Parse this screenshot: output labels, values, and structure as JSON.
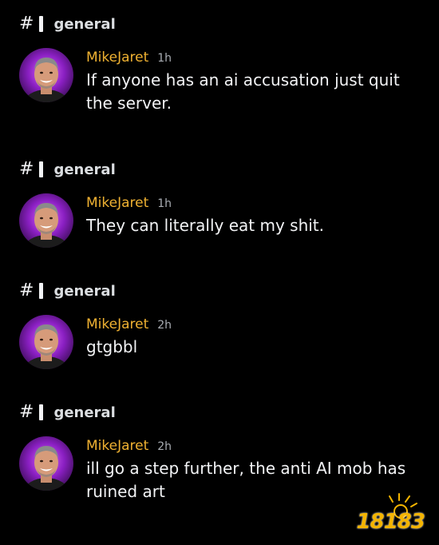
{
  "messages": [
    {
      "channel": "general",
      "username": "MikeJaret",
      "time": "1h",
      "text": "If anyone has an ai accusation just quit the server."
    },
    {
      "channel": "general",
      "username": "MikeJaret",
      "time": "1h",
      "text": "They can literally eat my shit."
    },
    {
      "channel": "general",
      "username": "MikeJaret",
      "time": "2h",
      "text": "gtgbbl"
    },
    {
      "channel": "general",
      "username": "MikeJaret",
      "time": "2h",
      "text": "ill go a step further, the anti AI mob has ruined art"
    }
  ],
  "watermark": "18183",
  "colors": {
    "background": "#000000",
    "username": "#f0b232",
    "timestamp": "#a9adb3",
    "message_text": "#f2f3f5",
    "avatar_glow": "#9b2fd6",
    "watermark": "#f4b400"
  },
  "icons": {
    "channel": "hash-icon",
    "avatar": "user-avatar"
  }
}
